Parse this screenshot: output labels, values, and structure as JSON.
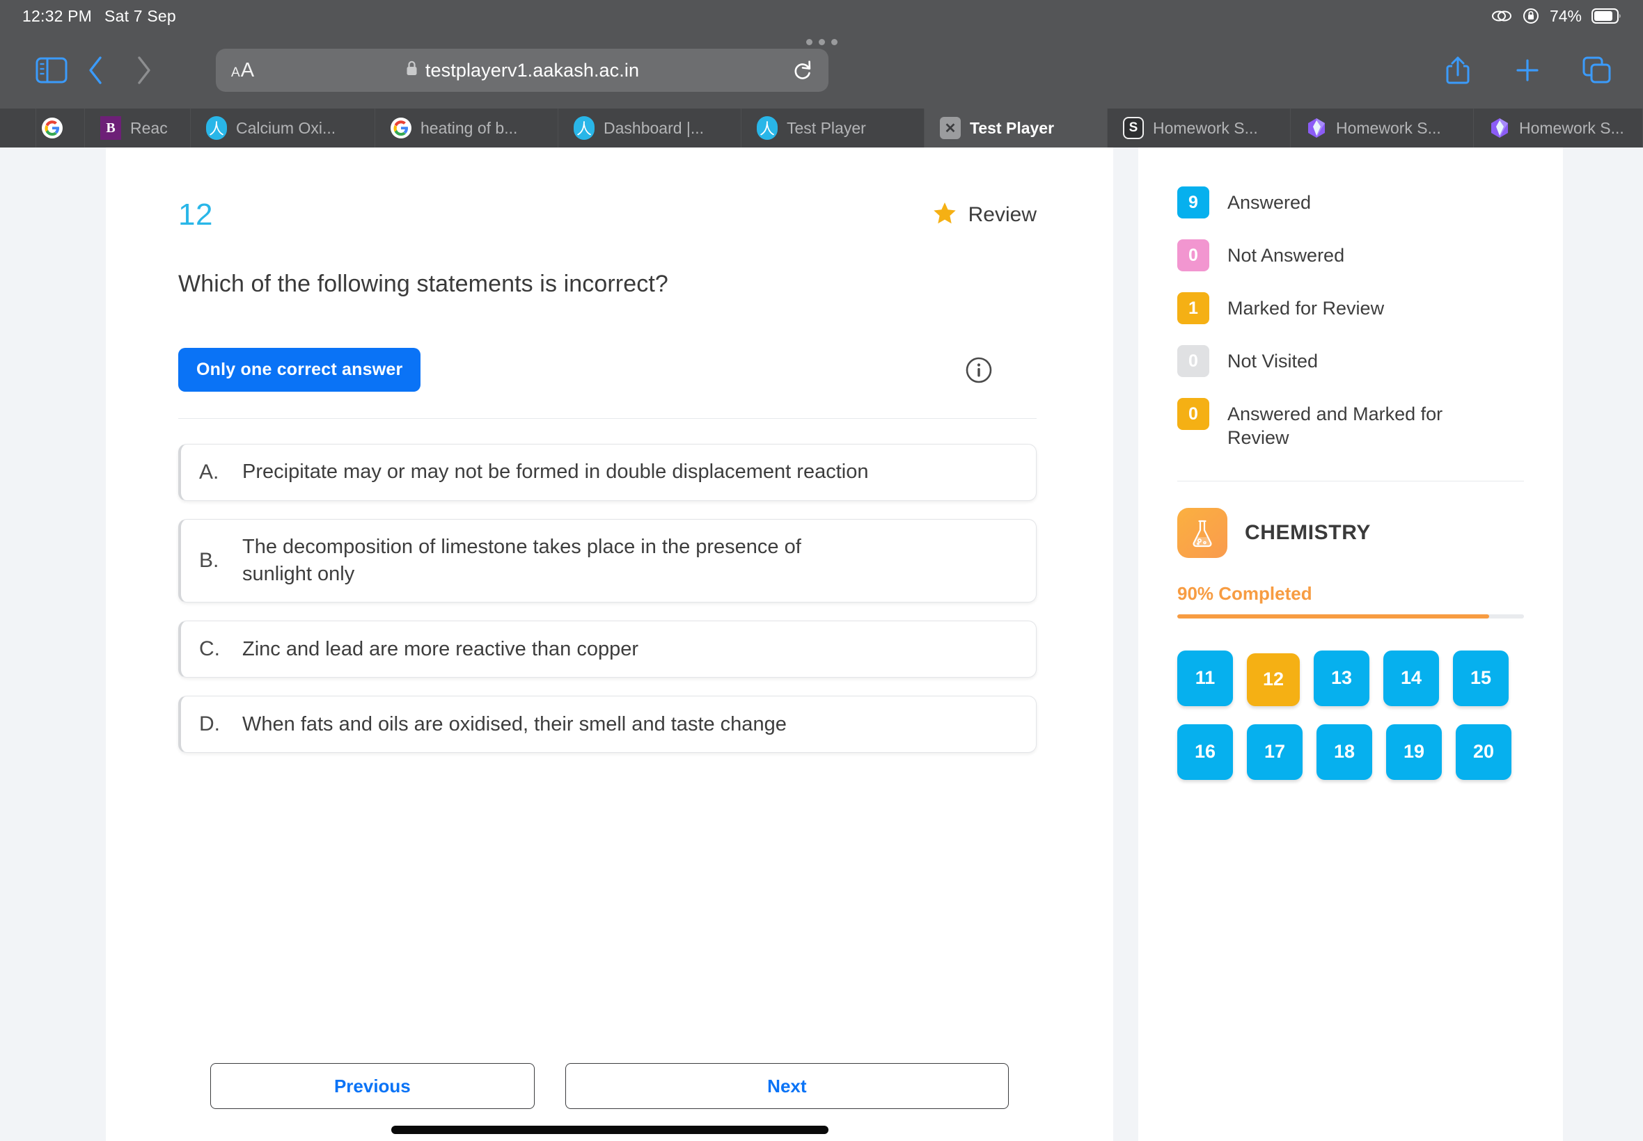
{
  "status_bar": {
    "time": "12:32 PM",
    "date": "Sat 7 Sep",
    "battery_percent": "74%",
    "icons": [
      "link-icon",
      "rotation-lock-icon",
      "battery-icon"
    ]
  },
  "toolbar": {
    "sidebar_icon": "sidebar-toggle-icon",
    "back_icon": "back-chevron-icon",
    "forward_icon": "forward-chevron-icon",
    "aa_small": "A",
    "aa_big": "A",
    "lock_icon": "lock-icon",
    "url": "testplayerv1.aakash.ac.in",
    "reload_icon": "reload-icon",
    "share_icon": "share-icon",
    "new_tab_icon": "plus-icon",
    "tabs_icon": "tab-overview-icon"
  },
  "tabs": [
    {
      "label": "",
      "favicon": "google-icon",
      "active": false
    },
    {
      "label": "Reac",
      "favicon": "brainly-icon",
      "active": false
    },
    {
      "label": "Calcium Oxi...",
      "favicon": "aakash-icon",
      "active": false
    },
    {
      "label": "heating of b...",
      "favicon": "google-icon",
      "active": false
    },
    {
      "label": "Dashboard |...",
      "favicon": "aakash-icon",
      "active": false
    },
    {
      "label": "Test Player",
      "favicon": "aakash-icon",
      "active": false
    },
    {
      "label": "Test Player",
      "favicon": "close-icon",
      "active": true
    },
    {
      "label": "Homework S...",
      "favicon": "s-letter-icon",
      "active": false
    },
    {
      "label": "Homework S...",
      "favicon": "gem-icon",
      "active": false
    },
    {
      "label": "Homework S...",
      "favicon": "gem-icon",
      "active": false
    }
  ],
  "question": {
    "number": "12",
    "review_label": "Review",
    "review_starred": true,
    "text": "Which of the following statements is incorrect?",
    "answer_type_badge": "Only one correct answer",
    "info_icon": "info-icon",
    "options": [
      {
        "letter": "A.",
        "text": "Precipitate may or may not be formed in double displacement reaction"
      },
      {
        "letter": "B.",
        "text": "The decomposition of limestone takes place in the presence of sunlight only"
      },
      {
        "letter": "C.",
        "text": "Zinc and lead are more reactive than copper"
      },
      {
        "letter": "D.",
        "text": "When fats and oils are oxidised, their smell and taste change"
      }
    ]
  },
  "footer": {
    "previous_label": "Previous",
    "next_label": "Next"
  },
  "panel": {
    "legend": [
      {
        "count": "9",
        "label": "Answered",
        "color": "#06b0ee",
        "checked": false
      },
      {
        "count": "0",
        "label": "Not Answered",
        "color": "#f296d0",
        "checked": false
      },
      {
        "count": "1",
        "label": "Marked for Review",
        "color": "#f5b014",
        "checked": false
      },
      {
        "count": "0",
        "label": "Not Visited",
        "color": "#e0e1e3",
        "checked": false
      },
      {
        "count": "0",
        "label": "Answered and Marked for Review",
        "color": "#f5b014",
        "checked": true
      }
    ],
    "subject": {
      "name": "CHEMISTRY",
      "icon": "flask-icon",
      "progress_label": "90% Completed",
      "progress_percent": 90,
      "accent_color": "#f79c42"
    },
    "question_grid": [
      {
        "number": "11",
        "state": "answered"
      },
      {
        "number": "12",
        "state": "current"
      },
      {
        "number": "13",
        "state": "answered"
      },
      {
        "number": "14",
        "state": "answered"
      },
      {
        "number": "15",
        "state": "answered"
      },
      {
        "number": "16",
        "state": "answered"
      },
      {
        "number": "17",
        "state": "answered"
      },
      {
        "number": "18",
        "state": "answered"
      },
      {
        "number": "19",
        "state": "answered"
      },
      {
        "number": "20",
        "state": "answered"
      }
    ]
  }
}
